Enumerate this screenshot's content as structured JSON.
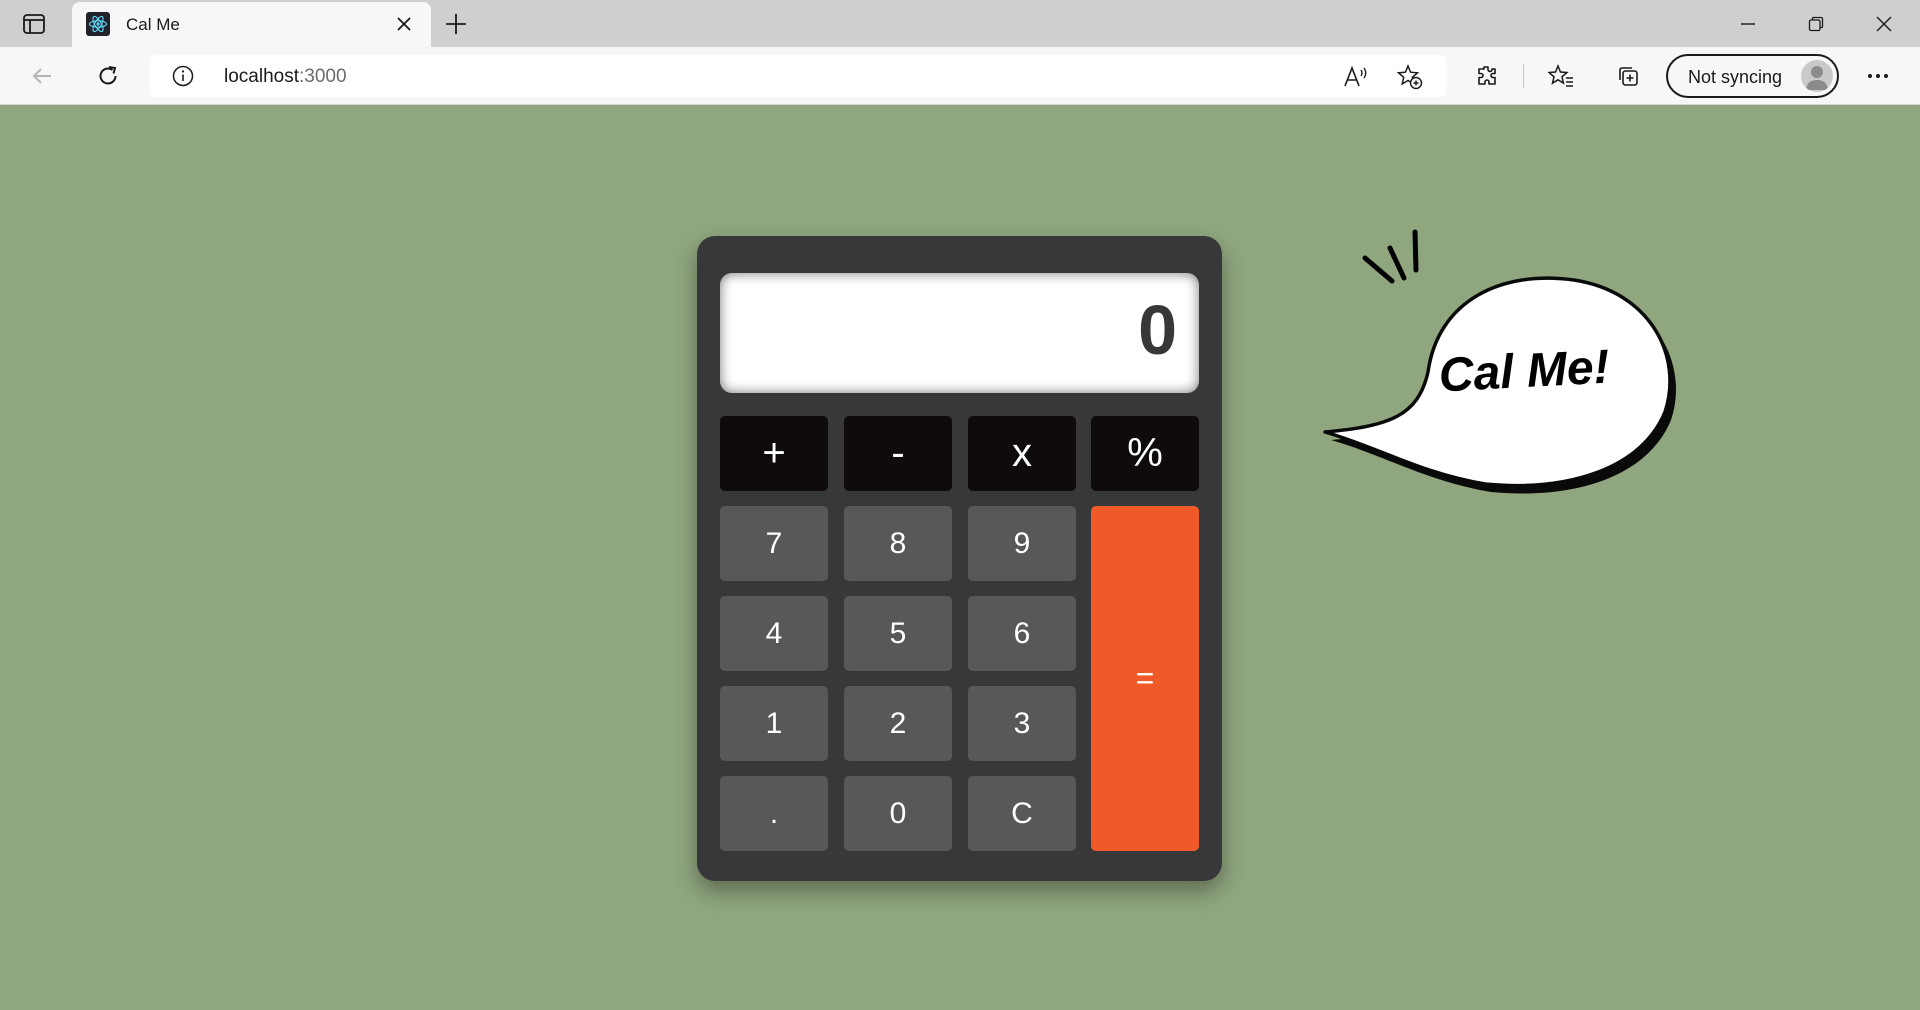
{
  "browser": {
    "tab_title": "Cal Me",
    "url_host": "localhost",
    "url_port": ":3000",
    "sync_label": "Not syncing"
  },
  "calculator": {
    "display": "0",
    "operators": [
      "+",
      "-",
      "x",
      "%"
    ],
    "digits": {
      "seven": "7",
      "eight": "8",
      "nine": "9",
      "four": "4",
      "five": "5",
      "six": "6",
      "one": "1",
      "two": "2",
      "three": "3",
      "decimal": ".",
      "zero": "0",
      "clear": "C"
    },
    "equals": "="
  },
  "bubble": {
    "text": "Cal Me!"
  },
  "colors": {
    "background": "#8fa67e",
    "calculator_body": "#38373a",
    "operator_key": "#0f0b0d",
    "digit_key": "#58585a",
    "equals_key": "#f05a28"
  }
}
